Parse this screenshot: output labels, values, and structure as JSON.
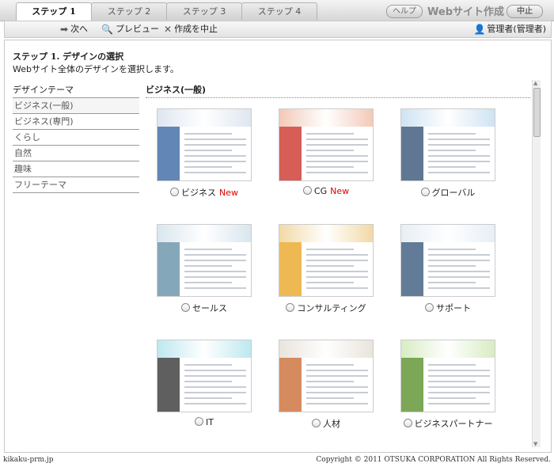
{
  "tabs": [
    {
      "label": "ステップ 1"
    },
    {
      "label": "ステップ 2"
    },
    {
      "label": "ステップ 3"
    },
    {
      "label": "ステップ 4"
    }
  ],
  "header": {
    "help": "ヘルプ",
    "site_title": "Webサイト作成",
    "stop": "中止"
  },
  "toolbar": {
    "next": "次へ",
    "preview": "プレビュー",
    "cancel": "作成を中止",
    "user": "管理者(管理者)"
  },
  "page": {
    "title": "ステップ 1. デザインの選択",
    "subtitle": "Webサイト全体のデザインを選択します。"
  },
  "sidebar": {
    "heading": "デザインテーマ",
    "items": [
      {
        "label": "ビジネス(一般)"
      },
      {
        "label": "ビジネス(専門)"
      },
      {
        "label": "くらし"
      },
      {
        "label": "自然"
      },
      {
        "label": "趣味"
      },
      {
        "label": "フリーテーマ"
      }
    ]
  },
  "category_title": "ビジネス(一般)",
  "designs": [
    {
      "name": "ビジネス",
      "new": "New",
      "colors": [
        "#dfe6f0",
        "#2e5d9e"
      ]
    },
    {
      "name": "CG",
      "new": "New",
      "colors": [
        "#f3c9b8",
        "#c9281e"
      ]
    },
    {
      "name": "グローバル",
      "new": "",
      "colors": [
        "#cfe3f3",
        "#2a4a6e"
      ]
    },
    {
      "name": "セールス",
      "new": "",
      "colors": [
        "#d9e6ee",
        "#5b8aa3"
      ]
    },
    {
      "name": "コンサルティング",
      "new": "",
      "colors": [
        "#f2d9a6",
        "#e8a21a"
      ]
    },
    {
      "name": "サポート",
      "new": "",
      "colors": [
        "#e8eef5",
        "#2d4f73"
      ]
    },
    {
      "name": "IT",
      "new": "",
      "colors": [
        "#bde8ef",
        "#2a2a2a"
      ]
    },
    {
      "name": "人材",
      "new": "",
      "colors": [
        "#e9e4dc",
        "#c8642a"
      ]
    },
    {
      "name": "ビジネスパートナー",
      "new": "",
      "colors": [
        "#d8ecc4",
        "#4f8a1e"
      ]
    }
  ],
  "footer": {
    "left": "kikaku-prm.jp",
    "right": "Copyright © 2011 OTSUKA CORPORATION All Rights Reserved."
  }
}
